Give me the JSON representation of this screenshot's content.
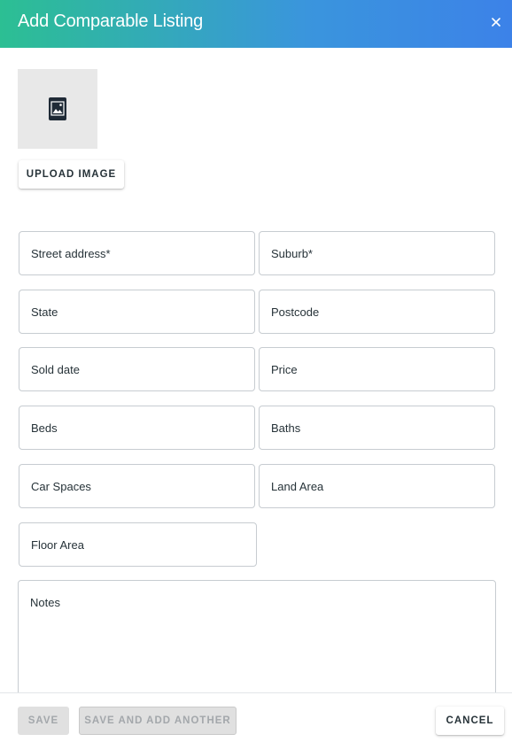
{
  "dialog": {
    "title": "Add Comparable Listing",
    "close_icon": "close-icon"
  },
  "image": {
    "placeholder_icon": "image-icon",
    "upload_label": "UPLOAD IMAGE"
  },
  "fields": {
    "street_address": "Street address*",
    "suburb": "Suburb*",
    "state": "State",
    "postcode": "Postcode",
    "sold_date": "Sold date",
    "price": "Price",
    "beds": "Beds",
    "baths": "Baths",
    "car_spaces": "Car Spaces",
    "land_area": "Land Area",
    "floor_area": "Floor Area",
    "notes": "Notes"
  },
  "footer": {
    "save_label": "SAVE",
    "save_add_label": "SAVE AND ADD ANOTHER",
    "cancel_label": "CANCEL"
  },
  "colors": {
    "header_gradient_start": "#2cbf93",
    "header_gradient_end": "#3c82e8",
    "text": "#263238",
    "field_border": "#c7ccd1",
    "disabled_bg": "#e0e0e0"
  }
}
